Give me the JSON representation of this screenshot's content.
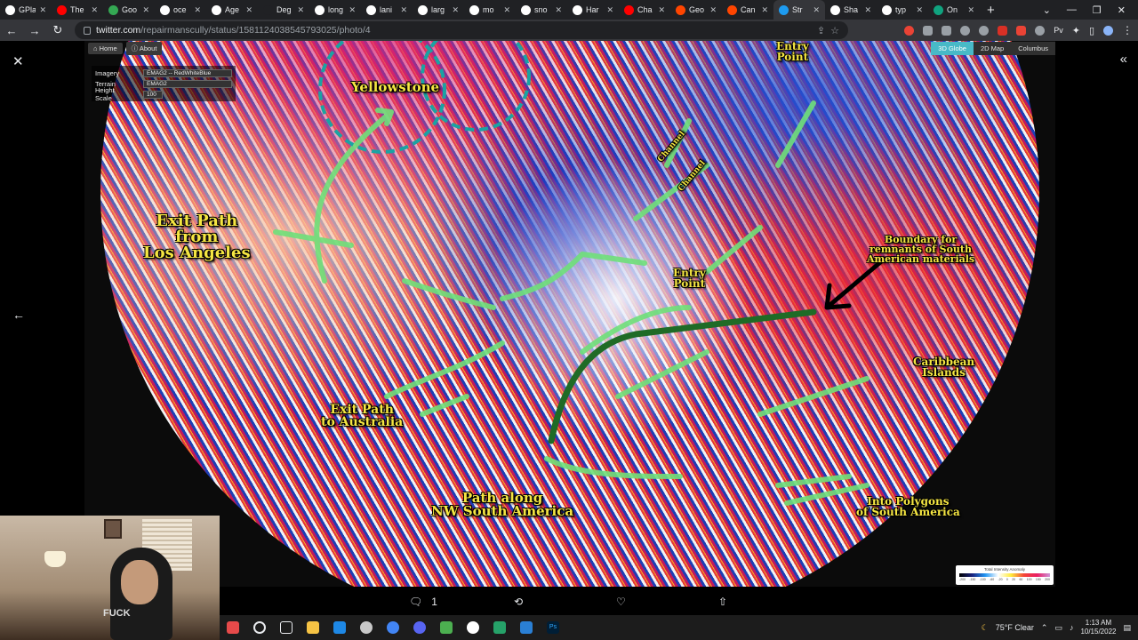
{
  "browser": {
    "tabs": [
      {
        "label": "GPla",
        "color": "#ffffff"
      },
      {
        "label": "The",
        "color": "#ff0000"
      },
      {
        "label": "Goo",
        "color": "#34a853"
      },
      {
        "label": "oce",
        "color": "#ffffff"
      },
      {
        "label": "Age",
        "color": "#ffffff"
      },
      {
        "label": "Deg",
        "color": "#202124"
      },
      {
        "label": "long",
        "color": "#ffffff"
      },
      {
        "label": "lani",
        "color": "#ffffff"
      },
      {
        "label": "larg",
        "color": "#ffffff"
      },
      {
        "label": "mo",
        "color": "#ffffff"
      },
      {
        "label": "sno",
        "color": "#ffffff"
      },
      {
        "label": "Har",
        "color": "#ffffff"
      },
      {
        "label": "Cha",
        "color": "#ff0000"
      },
      {
        "label": "Geo",
        "color": "#ff4500"
      },
      {
        "label": "Can",
        "color": "#ff4500"
      },
      {
        "label": "Str",
        "color": "#1d9bf0"
      },
      {
        "label": "Sha",
        "color": "#ffffff"
      },
      {
        "label": "typ",
        "color": "#ffffff"
      },
      {
        "label": "On",
        "color": "#10a37f"
      }
    ],
    "new_tab_label": "+",
    "url_host": "twitter.com",
    "url_path": "/repairmanscully/status/1581124038545793025/photo/4"
  },
  "photo": {
    "toolbar": {
      "home_label": "Home",
      "about_label": "About",
      "view_tabs": [
        "3D Globe",
        "2D Map",
        "Columbus"
      ],
      "active_view": "3D Globe"
    },
    "layers": {
      "imagery_label": "Imagery",
      "imagery_value": "EMAG2 -- RedWhiteBlue",
      "terrain_label": "Terrain",
      "terrain_value": "EMAG2",
      "height_label": "Height Scale",
      "height_value": "100"
    },
    "annotations": {
      "yellowstone": "Yellowstone",
      "entry_top_1": "Entry",
      "entry_top_2": "Point",
      "channel_1": "Channel",
      "channel_2": "Channel",
      "exit_la_1": "Exit Path",
      "exit_la_2": "from",
      "exit_la_3": "Los Angeles",
      "entry_mid_1": "Entry",
      "entry_mid_2": "Point",
      "boundary_1": "Boundary for",
      "boundary_2": "remnants of South",
      "boundary_3": "American materials",
      "caribbean_1": "Caribbean",
      "caribbean_2": "Islands",
      "exit_au_1": "Exit Path",
      "exit_au_2": "to Australia",
      "path_sa_1": "Path along",
      "path_sa_2": "NW South America",
      "polygons_1": "Into Polygons",
      "polygons_2": "of South America"
    },
    "legend": {
      "title": "Total Intensity Anomaly",
      "ticks": [
        "-200",
        "-150",
        "-100",
        "-60",
        "-20",
        "0",
        "20",
        "60",
        "100",
        "150",
        "200"
      ]
    },
    "colors": {
      "arrow_green": "#6fe07a",
      "arrow_dark": "#1f6b26",
      "text_yellow": "#f5e642"
    }
  },
  "tweet_actions": {
    "reply_count": "1"
  },
  "taskbar": {
    "weather": "75°F  Clear",
    "time": "1:13 AM",
    "date": "10/15/2022"
  },
  "webcam": {
    "shirt_text": "FUCK"
  }
}
